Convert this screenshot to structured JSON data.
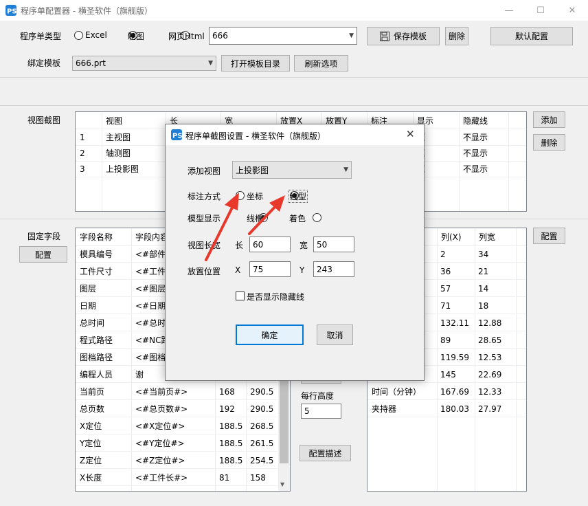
{
  "window": {
    "title": "程序单配置器 - 横圣软件（旗舰版）"
  },
  "type_row": {
    "label": "程序单类型",
    "options": [
      "Excel",
      "制图",
      "网页Html"
    ],
    "selected_index": 1,
    "template_name": "666",
    "save_label": "保存模板",
    "delete_label": "删除",
    "default_label": "默认配置"
  },
  "bind_row": {
    "label": "绑定模板",
    "value": "666.prt",
    "open_dir_label": "打开模板目录",
    "refresh_label": "刷新选项"
  },
  "views_section": {
    "label": "视图截图",
    "add_label": "添加",
    "delete_label": "删除",
    "columns": [
      "",
      "视图",
      "长",
      "宽",
      "放置X",
      "放置Y",
      "标注",
      "显示",
      "隐藏线"
    ],
    "rows": [
      [
        "1",
        "主视图",
        "",
        "",
        "",
        "",
        "",
        "框",
        "不显示"
      ],
      [
        "2",
        "轴测图",
        "",
        "",
        "",
        "",
        "",
        "框",
        "不显示"
      ],
      [
        "3",
        "上投影图",
        "",
        "",
        "",
        "",
        "",
        "框",
        "不显示"
      ]
    ]
  },
  "fixed_section": {
    "label": "固定字段",
    "config_label": "配置",
    "columns": [
      "字段名称",
      "字段内容",
      "",
      ""
    ],
    "rows": [
      [
        "模具编号",
        "<#部件名#>",
        "",
        ""
      ],
      [
        "工件尺寸",
        "<#工件尺寸#>",
        "",
        ""
      ],
      [
        "图层",
        "<#图层#>",
        "",
        ""
      ],
      [
        "日期",
        "<#日期#>",
        "",
        ""
      ],
      [
        "总时间",
        "<#总时间#>",
        "",
        ""
      ],
      [
        "程式路径",
        "<#NC路径#>",
        "",
        ""
      ],
      [
        "图档路径",
        "<#图档路径#>",
        "",
        ""
      ],
      [
        "编程人员",
        "谢",
        "",
        ""
      ],
      [
        "当前页",
        "<#当前页#>",
        "168",
        "290.5"
      ],
      [
        "总页数",
        "<#总页数#>",
        "192",
        "290.5"
      ],
      [
        "X定位",
        "<#X定位#>",
        "188.5",
        "268.5"
      ],
      [
        "Y定位",
        "<#Y定位#>",
        "188.5",
        "261.5"
      ],
      [
        "Z定位",
        "<#Z定位#>",
        "188.5",
        "254.5"
      ],
      [
        "X长度",
        "<#工件长#>",
        "81",
        "158"
      ]
    ]
  },
  "middle": {
    "row_height_label": "每行高度",
    "row_height_value": "5",
    "describe_label": "配置描述"
  },
  "right_section": {
    "config_label": "配置",
    "columns": [
      "",
      "列(X)",
      "列宽"
    ],
    "rows": [
      [
        "",
        "2",
        "34"
      ],
      [
        "",
        "36",
        "21"
      ],
      [
        "",
        "57",
        "14"
      ],
      [
        "",
        "71",
        "18"
      ],
      [
        "",
        "132.11",
        "12.88"
      ],
      [
        "",
        "89",
        "28.65"
      ],
      [
        "",
        "119.59",
        "12.53"
      ],
      [
        "",
        "145",
        "22.69"
      ],
      [
        "时间（分钟）",
        "167.69",
        "12.33"
      ],
      [
        "夹持器",
        "180.03",
        "27.97"
      ]
    ]
  },
  "dialog": {
    "title": "程序单截图设置 - 横圣软件（旗舰版）",
    "add_view_label": "添加视图",
    "add_view_value": "上投影图",
    "annot_label": "标注方式",
    "annot_options": [
      "坐标",
      "线型"
    ],
    "annot_selected": 1,
    "model_label": "模型显示",
    "model_options": [
      "线框",
      "着色"
    ],
    "model_selected": 0,
    "size_label": "视图长宽",
    "len_label": "长",
    "len_value": "60",
    "wid_label": "宽",
    "wid_value": "50",
    "pos_label": "放置位置",
    "x_label": "X",
    "x_value": "75",
    "y_label": "Y",
    "y_value": "243",
    "hidden_label": "是否显示隐藏线",
    "ok_label": "确定",
    "cancel_label": "取消"
  },
  "colors": {
    "arrow": "#e8382c",
    "focus_border": "#0078d7",
    "logo": "#1f7fd4"
  }
}
